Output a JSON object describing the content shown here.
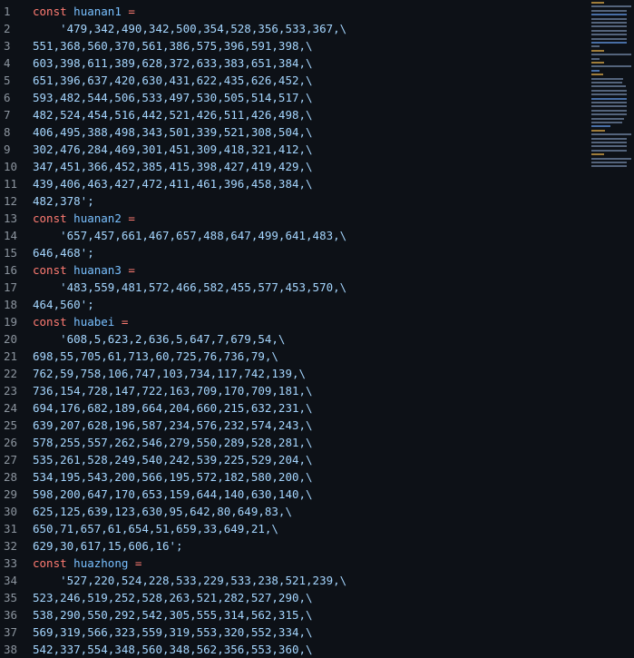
{
  "editor": {
    "lines": [
      {
        "n": "1",
        "kw": "const",
        "id": "huanan1",
        "op": "=",
        "str": ""
      },
      {
        "n": "2",
        "kw": "",
        "id": "",
        "op": "",
        "str": "    '479,342,490,342,500,354,528,356,533,367,\\"
      },
      {
        "n": "3",
        "kw": "",
        "id": "",
        "op": "",
        "str": "551,368,560,370,561,386,575,396,591,398,\\"
      },
      {
        "n": "4",
        "kw": "",
        "id": "",
        "op": "",
        "str": "603,398,611,389,628,372,633,383,651,384,\\"
      },
      {
        "n": "5",
        "kw": "",
        "id": "",
        "op": "",
        "str": "651,396,637,420,630,431,622,435,626,452,\\"
      },
      {
        "n": "6",
        "kw": "",
        "id": "",
        "op": "",
        "str": "593,482,544,506,533,497,530,505,514,517,\\"
      },
      {
        "n": "7",
        "kw": "",
        "id": "",
        "op": "",
        "str": "482,524,454,516,442,521,426,511,426,498,\\"
      },
      {
        "n": "8",
        "kw": "",
        "id": "",
        "op": "",
        "str": "406,495,388,498,343,501,339,521,308,504,\\"
      },
      {
        "n": "9",
        "kw": "",
        "id": "",
        "op": "",
        "str": "302,476,284,469,301,451,309,418,321,412,\\"
      },
      {
        "n": "10",
        "kw": "",
        "id": "",
        "op": "",
        "str": "347,451,366,452,385,415,398,427,419,429,\\"
      },
      {
        "n": "11",
        "kw": "",
        "id": "",
        "op": "",
        "str": "439,406,463,427,472,411,461,396,458,384,\\"
      },
      {
        "n": "12",
        "kw": "",
        "id": "",
        "op": "",
        "str": "482,378';"
      },
      {
        "n": "13",
        "kw": "const",
        "id": "huanan2",
        "op": "=",
        "str": ""
      },
      {
        "n": "14",
        "kw": "",
        "id": "",
        "op": "",
        "str": "    '657,457,661,467,657,488,647,499,641,483,\\"
      },
      {
        "n": "15",
        "kw": "",
        "id": "",
        "op": "",
        "str": "646,468';"
      },
      {
        "n": "16",
        "kw": "const",
        "id": "huanan3",
        "op": "=",
        "str": ""
      },
      {
        "n": "17",
        "kw": "",
        "id": "",
        "op": "",
        "str": "    '483,559,481,572,466,582,455,577,453,570,\\"
      },
      {
        "n": "18",
        "kw": "",
        "id": "",
        "op": "",
        "str": "464,560';"
      },
      {
        "n": "19",
        "kw": "const",
        "id": "huabei",
        "op": "=",
        "str": ""
      },
      {
        "n": "20",
        "kw": "",
        "id": "",
        "op": "",
        "str": "    '608,5,623,2,636,5,647,7,679,54,\\"
      },
      {
        "n": "21",
        "kw": "",
        "id": "",
        "op": "",
        "str": "698,55,705,61,713,60,725,76,736,79,\\"
      },
      {
        "n": "22",
        "kw": "",
        "id": "",
        "op": "",
        "str": "762,59,758,106,747,103,734,117,742,139,\\"
      },
      {
        "n": "23",
        "kw": "",
        "id": "",
        "op": "",
        "str": "736,154,728,147,722,163,709,170,709,181,\\"
      },
      {
        "n": "24",
        "kw": "",
        "id": "",
        "op": "",
        "str": "694,176,682,189,664,204,660,215,632,231,\\"
      },
      {
        "n": "25",
        "kw": "",
        "id": "",
        "op": "",
        "str": "639,207,628,196,587,234,576,232,574,243,\\"
      },
      {
        "n": "26",
        "kw": "",
        "id": "",
        "op": "",
        "str": "578,255,557,262,546,279,550,289,528,281,\\"
      },
      {
        "n": "27",
        "kw": "",
        "id": "",
        "op": "",
        "str": "535,261,528,249,540,242,539,225,529,204,\\"
      },
      {
        "n": "28",
        "kw": "",
        "id": "",
        "op": "",
        "str": "534,195,543,200,566,195,572,182,580,200,\\"
      },
      {
        "n": "29",
        "kw": "",
        "id": "",
        "op": "",
        "str": "598,200,647,170,653,159,644,140,630,140,\\"
      },
      {
        "n": "30",
        "kw": "",
        "id": "",
        "op": "",
        "str": "625,125,639,123,630,95,642,80,649,83,\\"
      },
      {
        "n": "31",
        "kw": "",
        "id": "",
        "op": "",
        "str": "650,71,657,61,654,51,659,33,649,21,\\"
      },
      {
        "n": "32",
        "kw": "",
        "id": "",
        "op": "",
        "str": "629,30,617,15,606,16';"
      },
      {
        "n": "33",
        "kw": "const",
        "id": "huazhong",
        "op": "=",
        "str": ""
      },
      {
        "n": "34",
        "kw": "",
        "id": "",
        "op": "",
        "str": "    '527,220,524,228,533,229,533,238,521,239,\\"
      },
      {
        "n": "35",
        "kw": "",
        "id": "",
        "op": "",
        "str": "523,246,519,252,528,263,521,282,527,290,\\"
      },
      {
        "n": "36",
        "kw": "",
        "id": "",
        "op": "",
        "str": "538,290,550,292,542,305,555,314,562,315,\\"
      },
      {
        "n": "37",
        "kw": "",
        "id": "",
        "op": "",
        "str": "569,319,566,323,559,319,553,320,552,334,\\"
      },
      {
        "n": "38",
        "kw": "",
        "id": "",
        "op": "",
        "str": "542,337,554,348,560,348,562,356,553,360,\\"
      }
    ]
  },
  "colors": {
    "background": "#0d1117",
    "line_number": "#8b949e",
    "keyword": "#ff7b72",
    "identifier": "#79c0ff",
    "string": "#a5d6ff"
  },
  "icons": {
    "minimap": "minimap-overview"
  }
}
